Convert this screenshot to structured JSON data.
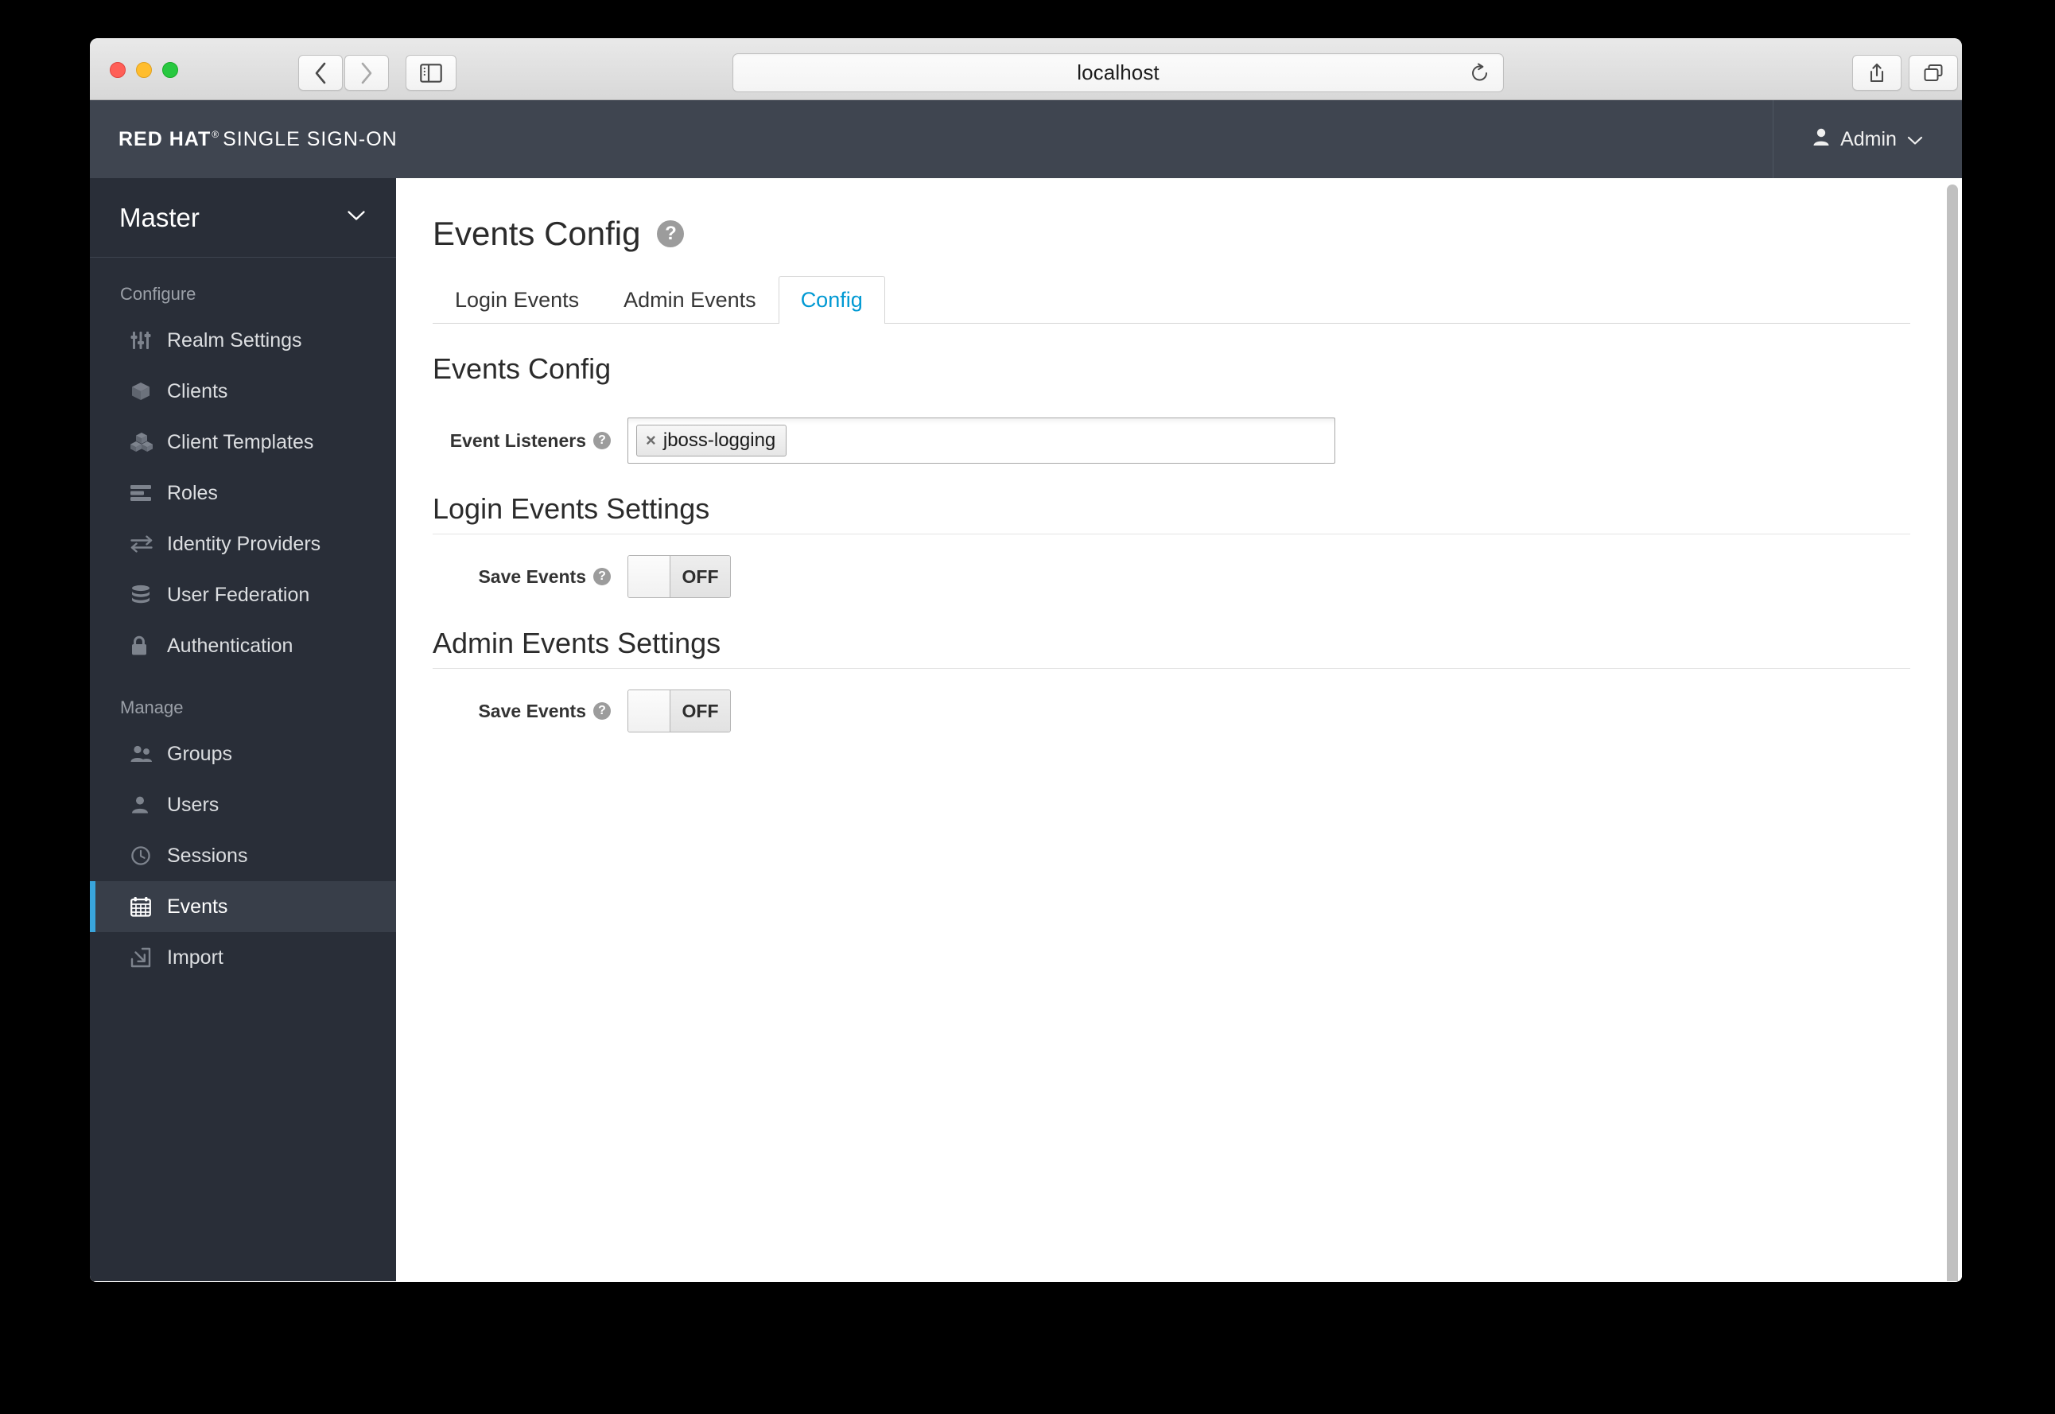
{
  "browser": {
    "url": "localhost",
    "back_label": "Back",
    "forward_label": "Forward",
    "sidebar_toggle_label": "Show Sidebar",
    "reload_label": "Reload",
    "share_label": "Share",
    "tabs_label": "Show Tab Overview",
    "new_tab_label": "+"
  },
  "header": {
    "brand_bold": "RED HAT",
    "brand_reg": "®",
    "brand_rest": "SINGLE SIGN-ON",
    "user": "Admin",
    "user_caret": "⌄"
  },
  "sidebar": {
    "realm": "Master",
    "groups": [
      {
        "label": "Configure",
        "items": [
          {
            "label": "Realm Settings",
            "icon": "sliders-icon",
            "active": false
          },
          {
            "label": "Clients",
            "icon": "cube-icon",
            "active": false
          },
          {
            "label": "Client Templates",
            "icon": "cubes-icon",
            "active": false
          },
          {
            "label": "Roles",
            "icon": "list-icon",
            "active": false
          },
          {
            "label": "Identity Providers",
            "icon": "exchange-icon",
            "active": false
          },
          {
            "label": "User Federation",
            "icon": "database-icon",
            "active": false
          },
          {
            "label": "Authentication",
            "icon": "lock-icon",
            "active": false
          }
        ]
      },
      {
        "label": "Manage",
        "items": [
          {
            "label": "Groups",
            "icon": "users-icon",
            "active": false
          },
          {
            "label": "Users",
            "icon": "user-icon",
            "active": false
          },
          {
            "label": "Sessions",
            "icon": "clock-icon",
            "active": false
          },
          {
            "label": "Events",
            "icon": "calendar-icon",
            "active": true
          },
          {
            "label": "Import",
            "icon": "import-icon",
            "active": false
          }
        ]
      }
    ]
  },
  "main": {
    "page_title": "Events Config",
    "page_help": "?",
    "tabs": [
      {
        "label": "Login Events",
        "active": false
      },
      {
        "label": "Admin Events",
        "active": false
      },
      {
        "label": "Config",
        "active": true
      }
    ],
    "events_config": {
      "section_title": "Events Config",
      "event_listeners_label": "Event Listeners",
      "event_listeners_help": "?",
      "tokens": [
        {
          "label": "jboss-logging",
          "remove": "×"
        }
      ]
    },
    "login_events_settings": {
      "section_title": "Login Events Settings",
      "save_events_label": "Save Events",
      "save_events_help": "?",
      "save_events_state": "OFF"
    },
    "admin_events_settings": {
      "section_title": "Admin Events Settings",
      "save_events_label": "Save Events",
      "save_events_help": "?",
      "save_events_state": "OFF"
    }
  },
  "colors": {
    "header_bg": "#3f4550",
    "sidebar_bg": "#292e38",
    "active_accent": "#39a5dc",
    "tab_active_text": "#0099d3"
  }
}
